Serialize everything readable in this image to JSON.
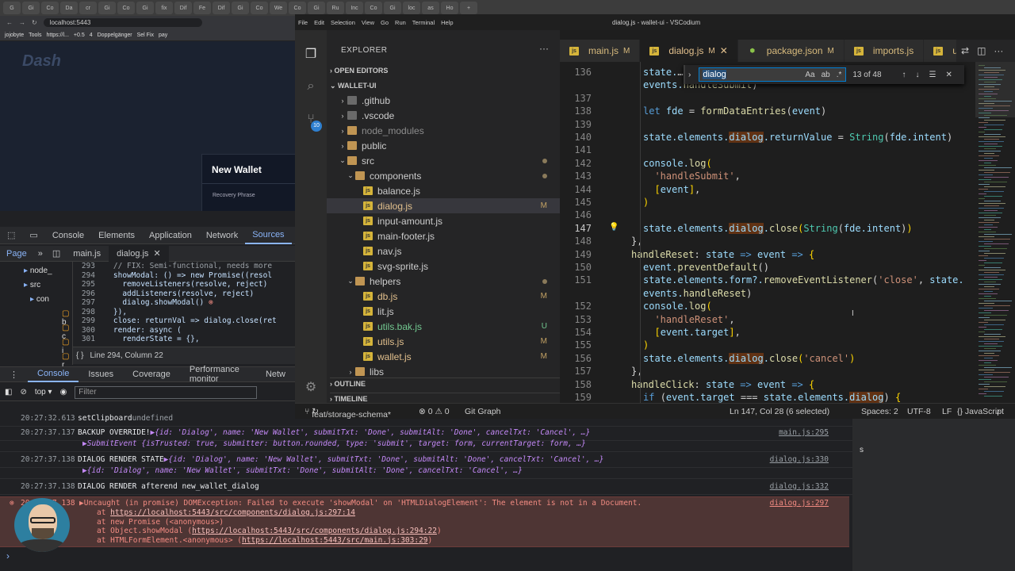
{
  "browser": {
    "tabs": [
      "G",
      "Gi",
      "Co",
      "Da",
      "cr",
      "Gi",
      "Co",
      "Gi",
      "fix",
      "Dif",
      "Fe",
      "Dif",
      "Gi",
      "Co",
      "We",
      "Co",
      "Gi",
      "Ru",
      "Inc",
      "Co",
      "Gi",
      "loc",
      "as",
      "Ho"
    ],
    "url": "localhost:5443",
    "bookmarks": [
      "jojobyte",
      "Tools",
      "https://l...",
      "+0.5",
      "4",
      "Doppelgänger",
      "Sel Fix",
      "pay"
    ],
    "page": {
      "logo": "Dash",
      "dialog_title": "New Wallet",
      "dialog_label": "Recovery Phrase"
    }
  },
  "devtools": {
    "main_tabs": [
      "Console",
      "Elements",
      "Application",
      "Network",
      "Sources"
    ],
    "active_tab": "Sources",
    "sub": {
      "page": "Page",
      "files": [
        "main.js",
        "dialog.js"
      ]
    },
    "tree": [
      "node_",
      "src",
      "con",
      "b",
      "c",
      "i",
      "r"
    ],
    "code_lines": [
      {
        "n": "293",
        "t": "    // FIX: Semi-functional, needs more"
      },
      {
        "n": "294",
        "t": "    showModal: () => new Promise((resol"
      },
      {
        "n": "295",
        "t": "      removeListeners(resolve, reject)"
      },
      {
        "n": "296",
        "t": "      addListeners(resolve, reject)"
      },
      {
        "n": "297",
        "t": "      dialog.showModal()"
      },
      {
        "n": "298",
        "t": "    }),"
      },
      {
        "n": "299",
        "t": "    close: returnVal => dialog.close(ret"
      },
      {
        "n": "300",
        "t": "    render: async ("
      },
      {
        "n": "301",
        "t": "      renderState = {},"
      }
    ],
    "status": "Line 294, Column 22",
    "drawer_tabs": [
      "Console",
      "Issues",
      "Coverage",
      "Performance monitor",
      "Netw"
    ],
    "context": "top",
    "filter_placeholder": "Filter"
  },
  "console": {
    "rows": [
      {
        "ts": "20:27:32.613",
        "msg": "setClipboard",
        "extra": "undefined",
        "src": ""
      },
      {
        "ts": "20:27:37.137",
        "msg": "BACKUP OVERRIDE!",
        "extra": "▶{id: 'Dialog', name: 'New Wallet', submitTxt: 'Done', submitAlt: 'Done', cancelTxt: 'Cancel', …}",
        "src": "main.js:295"
      },
      {
        "ts": "",
        "msg": "",
        "extra": "▶SubmitEvent {isTrusted: true, submitter: button.rounded, type: 'submit', target: form, currentTarget: form, …}",
        "src": ""
      },
      {
        "ts": "20:27:37.138",
        "msg": "DIALOG RENDER STATE",
        "extra": "▶{id: 'Dialog', name: 'New Wallet', submitTxt: 'Done', submitAlt: 'Done', cancelTxt: 'Cancel', …}",
        "src": "dialog.js:330"
      },
      {
        "ts": "",
        "msg": "",
        "extra": "▶{id: 'Dialog', name: 'New Wallet', submitTxt: 'Done', submitAlt: 'Done', cancelTxt: 'Cancel', …}",
        "src": ""
      },
      {
        "ts": "20:27:37.138",
        "msg": "DIALOG RENDER afterend new_wallet_dialog",
        "extra": "",
        "src": "dialog.js:332"
      }
    ],
    "error": {
      "ts": "20:27:37.138",
      "msg": "▶Uncaught (in promise) DOMException: Failed to execute 'showModal' on 'HTMLDialogElement': The element is not in a Document.",
      "src": "dialog.js:297",
      "stack": [
        {
          "pre": "at ",
          "link": "https://localhost:5443/src/components/dialog.js:297:14",
          "post": ""
        },
        {
          "pre": "at new Promise (<anonymous>)",
          "link": "",
          "post": ""
        },
        {
          "pre": "at Object.showModal (",
          "link": "https://localhost:5443/src/components/dialog.js:294:22",
          "post": ")"
        },
        {
          "pre": "at HTMLFormElement.<anonymous> (",
          "link": "https://localhost:5443/src/main.js:303:29",
          "post": ")"
        }
      ]
    }
  },
  "vscode": {
    "title": "dialog.js - wallet-ui - VSCodium",
    "menu": [
      "File",
      "Edit",
      "Selection",
      "View",
      "Go",
      "Run",
      "Terminal",
      "Help"
    ],
    "explorer": {
      "header": "EXPLORER",
      "open_editors": "OPEN EDITORS",
      "root": "WALLET-UI",
      "outline": "OUTLINE",
      "timeline": "TIMELINE"
    },
    "tree": [
      {
        "name": ".github",
        "type": "folder",
        "depth": 1,
        "open": false,
        "flag": ""
      },
      {
        "name": ".vscode",
        "type": "folder",
        "depth": 1,
        "open": false,
        "flag": ""
      },
      {
        "name": "node_modules",
        "type": "folder",
        "depth": 1,
        "open": false,
        "flag": "",
        "dim": true
      },
      {
        "name": "public",
        "type": "folder",
        "depth": 1,
        "open": false,
        "flag": ""
      },
      {
        "name": "src",
        "type": "folder",
        "depth": 1,
        "open": true,
        "flag": "dot"
      },
      {
        "name": "components",
        "type": "folder",
        "depth": 2,
        "open": true,
        "flag": "dot"
      },
      {
        "name": "balance.js",
        "type": "js",
        "depth": 3,
        "flag": ""
      },
      {
        "name": "dialog.js",
        "type": "js",
        "depth": 3,
        "flag": "M",
        "selected": true
      },
      {
        "name": "input-amount.js",
        "type": "js",
        "depth": 3,
        "flag": ""
      },
      {
        "name": "main-footer.js",
        "type": "js",
        "depth": 3,
        "flag": ""
      },
      {
        "name": "nav.js",
        "type": "js",
        "depth": 3,
        "flag": ""
      },
      {
        "name": "svg-sprite.js",
        "type": "js",
        "depth": 3,
        "flag": ""
      },
      {
        "name": "helpers",
        "type": "folder",
        "depth": 2,
        "open": true,
        "flag": "dot"
      },
      {
        "name": "db.js",
        "type": "js",
        "depth": 3,
        "flag": "M"
      },
      {
        "name": "lit.js",
        "type": "js",
        "depth": 3,
        "flag": ""
      },
      {
        "name": "utils.bak.js",
        "type": "js",
        "depth": 3,
        "flag": "U"
      },
      {
        "name": "utils.js",
        "type": "js",
        "depth": 3,
        "flag": "M"
      },
      {
        "name": "wallet.js",
        "type": "js",
        "depth": 3,
        "flag": "M"
      },
      {
        "name": "libs",
        "type": "folder",
        "depth": 2,
        "open": false,
        "flag": ""
      }
    ],
    "tabs": [
      {
        "name": "main.js",
        "flag": "M"
      },
      {
        "name": "dialog.js",
        "flag": "M",
        "active": true
      },
      {
        "name": "package.json",
        "flag": "M"
      },
      {
        "name": "imports.js",
        "flag": ""
      },
      {
        "name": "ut",
        "flag": ""
      }
    ],
    "find": {
      "query": "dialog",
      "count": "13 of 48"
    },
    "code": [
      {
        "n": "136",
        "h": "state.<span class='p'>…</span>"
      },
      {
        "n": "",
        "h": "events.<span class='f'>handleSubmit</span><span class='p'>)</span>"
      },
      {
        "n": "137",
        "h": ""
      },
      {
        "n": "138",
        "h": "<span class='k'>let</span> fde <span class='p'>=</span> <span class='f'>formDataEntries</span><span class='p'>(</span>event<span class='p'>)</span>"
      },
      {
        "n": "139",
        "h": ""
      },
      {
        "n": "140",
        "h": "state.elements.<span class='hl'>dialog</span>.returnValue <span class='p'>=</span> <span class='ty'>String</span><span class='p'>(</span>fde.intent<span class='p'>)</span>"
      },
      {
        "n": "141",
        "h": ""
      },
      {
        "n": "142",
        "h": "console.<span class='f'>log</span><span class='y'>(</span>"
      },
      {
        "n": "143",
        "h": "  <span class='s'>'handleSubmit'</span><span class='p'>,</span>"
      },
      {
        "n": "144",
        "h": "  <span class='y'>[</span>event<span class='y'>]</span><span class='p'>,</span>"
      },
      {
        "n": "145",
        "h": "<span class='y'>)</span>"
      },
      {
        "n": "146",
        "h": ""
      },
      {
        "n": "147",
        "h": "state.elements.<span class='hl'>dialog</span>.<span class='f'>close</span><span class='y'>(</span><span class='ty'>String</span><span class='p'>(</span>fde.intent<span class='p'>)</span><span class='y'>)</span>"
      },
      {
        "n": "148",
        "h": "<span class='p'>},</span>",
        "o": -2
      },
      {
        "n": "149",
        "h": "<span class='f'>handleReset</span><span class='p'>:</span> state <span class='k'>=&gt;</span> event <span class='k'>=&gt;</span> <span class='y'>{</span>",
        "o": -2
      },
      {
        "n": "150",
        "h": "event.<span class='f'>preventDefault</span><span class='p'>()</span>"
      },
      {
        "n": "151",
        "h": "state.elements.form?.<span class='f'>removeEventListener</span><span class='p'>(</span><span class='s'>'close'</span><span class='p'>,</span> state."
      },
      {
        "n": "",
        "h": "events.<span class='f'>handleReset</span><span class='p'>)</span>"
      },
      {
        "n": "152",
        "h": "console.<span class='f'>log</span><span class='y'>(</span>"
      },
      {
        "n": "153",
        "h": "  <span class='s'>'handleReset'</span><span class='p'>,</span>"
      },
      {
        "n": "154",
        "h": "  <span class='y'>[</span>event.target<span class='y'>]</span><span class='p'>,</span>"
      },
      {
        "n": "155",
        "h": "<span class='y'>)</span>"
      },
      {
        "n": "156",
        "h": "state.elements.<span class='hl'>dialog</span>.<span class='f'>close</span><span class='y'>(</span><span class='s'>'cancel'</span><span class='y'>)</span>"
      },
      {
        "n": "157",
        "h": "<span class='p'>},</span>",
        "o": -2
      },
      {
        "n": "158",
        "h": "<span class='f'>handleClick</span><span class='p'>:</span> state <span class='k'>=&gt;</span> event <span class='k'>=&gt;</span> <span class='y'>{</span>",
        "o": -2
      },
      {
        "n": "159",
        "h": "<span class='k'>if</span> <span class='p'>(</span>event.target <span class='p'>===</span> state.elements.<span class='hl'>dialog</span><span class='p'>)</span> <span class='y'>{</span>"
      }
    ],
    "status": {
      "branch": "feat/storage-schema*",
      "problems": "⊗ 0 ⚠ 0",
      "graph": "Git Graph",
      "position": "Ln 147, Col 28 (6 selected)",
      "spaces": "Spaces: 2",
      "encoding": "UTF-8",
      "eol": "LF",
      "language": "{} JavaScript"
    },
    "badge": "10"
  },
  "misc": {
    "right_panel_letter": "s"
  }
}
